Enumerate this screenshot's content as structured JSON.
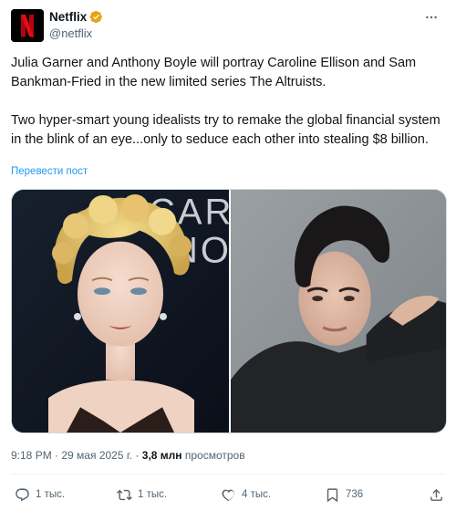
{
  "account": {
    "display_name": "Netflix",
    "handle": "@netflix",
    "avatar_letter": "N",
    "brand_color": "#e50914",
    "verified_color": "#e8a317"
  },
  "tweet": {
    "paragraph_1": "Julia Garner and Anthony Boyle will portray Caroline Ellison and Sam Bankman-Fried in the new limited series The Altruists.",
    "paragraph_2": "Two hyper-smart young idealists try to remake the global financial system in the blink of an eye...only to seduce each other into stealing $8 billion.",
    "translate_label": "Перевести пост"
  },
  "media": {
    "left_backdrop_text": [
      "CAR",
      "NO"
    ]
  },
  "meta": {
    "time": "9:18 PM",
    "separator": " · ",
    "date": "29 мая 2025 г.",
    "views_count": "3,8 млн",
    "views_label": "просмотров"
  },
  "actions": {
    "replies": "1 тыс.",
    "retweets": "1 тыс.",
    "likes": "4 тыс.",
    "bookmarks": "736"
  },
  "colors": {
    "text": "#0f1419",
    "secondary": "#536471",
    "link": "#1d9bf0"
  },
  "icons": [
    "verified-badge-icon",
    "more-icon",
    "reply-icon",
    "retweet-icon",
    "like-icon",
    "bookmark-icon",
    "share-icon"
  ]
}
